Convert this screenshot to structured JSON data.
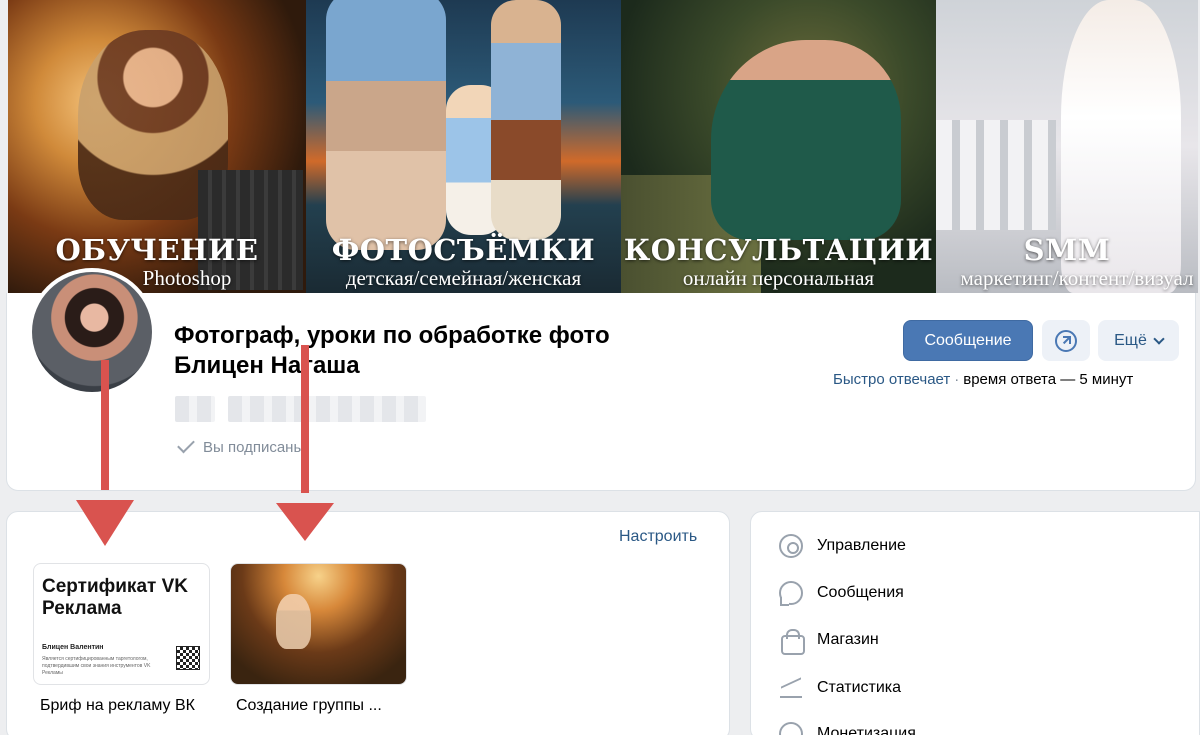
{
  "cover": {
    "panels": [
      {
        "title": "ОБУЧЕНИЕ",
        "subtitle": "Photoshop"
      },
      {
        "title": "ФОТОСЪЁМКИ",
        "subtitle": "детская/семейная/женская"
      },
      {
        "title": "КОНСУЛЬТАЦИИ",
        "subtitle": "онлайн персональная"
      },
      {
        "title": "SMM",
        "subtitle": "маркетинг/контент/визуал"
      }
    ]
  },
  "header": {
    "title_line1": "Фотограф, уроки по обработке фото",
    "title_line2": "Блицен Наташа",
    "subscribed": "Вы подписаны"
  },
  "actions": {
    "message": "Сообщение",
    "more": "Ещё",
    "reply_fast": "Быстро отвечает",
    "reply_time": "время ответа — 5 минут"
  },
  "section": {
    "customize": "Настроить",
    "items": [
      {
        "caption": "Бриф на рекламу ВК",
        "cert_title": "Сертификат VK Реклама",
        "cert_name": "Блицен Валентин",
        "cert_text": "Является сертифицированным таргетологом, подтвердившим свои знания инструментов VK Рекламы"
      },
      {
        "caption": "Создание группы ..."
      }
    ]
  },
  "menu": {
    "items": [
      {
        "label": "Управление",
        "icon": "gear-icon"
      },
      {
        "label": "Сообщения",
        "icon": "message-bubble-icon"
      },
      {
        "label": "Магазин",
        "icon": "shopping-bag-icon"
      },
      {
        "label": "Статистика",
        "icon": "stats-icon"
      },
      {
        "label": "Монетизация",
        "icon": "coin-icon"
      }
    ]
  },
  "colors": {
    "accent": "#4a78b4",
    "link": "#2a5885",
    "arrow": "#d9534f",
    "background": "#edeef0"
  }
}
